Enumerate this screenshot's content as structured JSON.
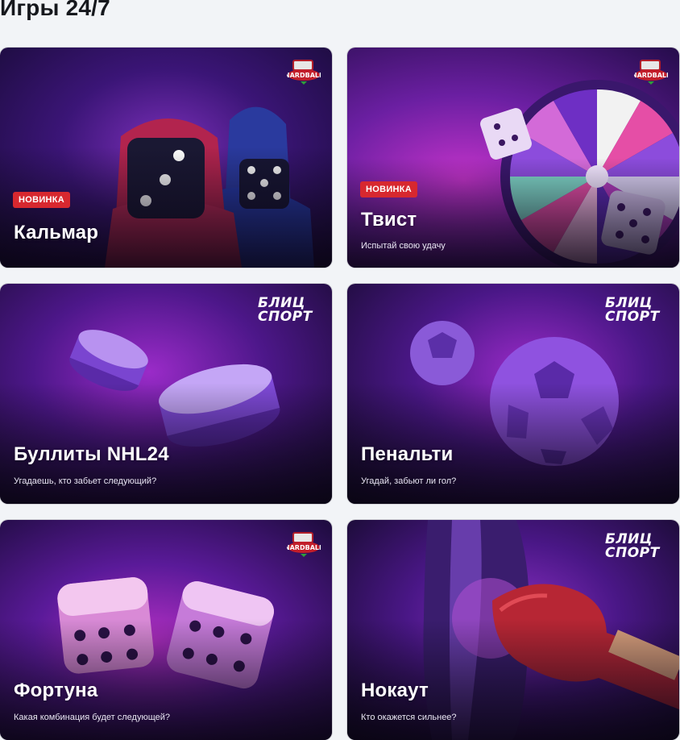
{
  "page": {
    "title": "Игры 24/7"
  },
  "cards": [
    {
      "title": "Кальмар",
      "badge": "НОВИНКА",
      "subtitle": "",
      "brand": "NARDBALL"
    },
    {
      "title": "Твист",
      "badge": "НОВИНКА",
      "subtitle": "Испытай свою удачу",
      "brand": "NARDBALL"
    },
    {
      "title": "Буллиты NHL24",
      "badge": "",
      "subtitle": "Угадаешь, кто забьет следующий?",
      "brand_line1": "БЛИЦ",
      "brand_line2": "СПОРТ"
    },
    {
      "title": "Пенальти",
      "badge": "",
      "subtitle": "Угадай, забьют ли гол?",
      "brand_line1": "БЛИЦ",
      "brand_line2": "СПОРТ"
    },
    {
      "title": "Фортуна",
      "badge": "",
      "subtitle": "Какая комбинация будет следующей?",
      "brand": "NARDBALL"
    },
    {
      "title": "Нокаут",
      "badge": "",
      "subtitle": "Кто окажется сильнее?",
      "brand_line1": "БЛИЦ",
      "brand_line2": "СПОРТ"
    }
  ],
  "colors": {
    "badge": "#d7282f",
    "page_bg": "#f2f4f7",
    "accent_purple": "#8b2fd6"
  }
}
